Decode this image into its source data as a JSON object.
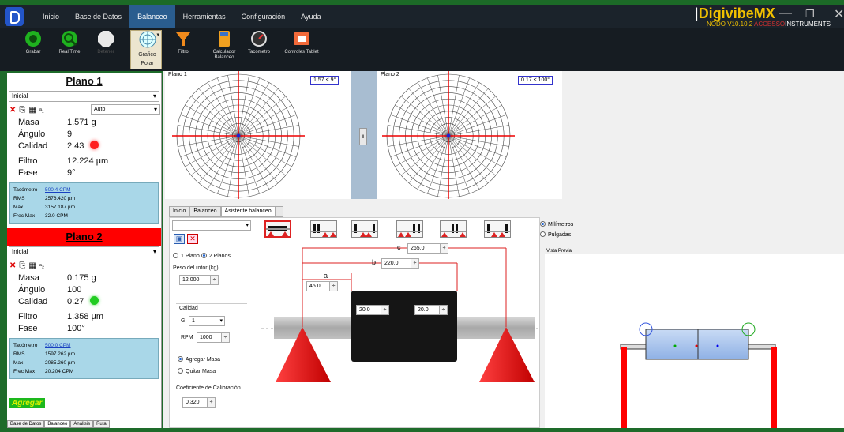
{
  "titlebar": {
    "menu": [
      "Inicio",
      "Base de Datos",
      "Balanceo",
      "Herramientas",
      "Configuración",
      "Ayuda"
    ],
    "active_menu": "Balanceo",
    "brand": "DigivibeMX",
    "brand_version": "NODO V10.10.2",
    "brand_sub_acc": "ACCESSO",
    "brand_sub_ins": "INSTRUMENTS"
  },
  "ribbon": {
    "buttons": [
      {
        "label": "Grabar",
        "icon": "record-icon"
      },
      {
        "label": "Real Time",
        "icon": "realtime-icon"
      },
      {
        "label": "Detener",
        "icon": "stop-icon"
      },
      {
        "label": "Grafico Polar",
        "icon": "polar-chart-icon"
      },
      {
        "label": "Filtro",
        "icon": "filter-icon"
      },
      {
        "label": "Calculador Balanceo",
        "icon": "calculator-icon"
      },
      {
        "label": "Tacómetro",
        "icon": "tachometer-icon"
      },
      {
        "label": "Controles Tablet",
        "icon": "tablet-icon"
      }
    ]
  },
  "plano1": {
    "title": "Plano 1",
    "combo": "Inicial",
    "mode": "Auto",
    "masa_label": "Masa",
    "masa": "1.571 g",
    "angulo_label": "Ángulo",
    "angulo": "9",
    "calidad_label": "Calidad",
    "calidad": "2.43",
    "calidad_color": "#ff2020",
    "filtro_label": "Filtro",
    "filtro": "12.224 µm",
    "fase_label": "Fase",
    "fase": "9°",
    "info": [
      {
        "k": "Tacómetro",
        "v": "500.4 CPM"
      },
      {
        "k": "RMS",
        "v": "2576.420 µm"
      },
      {
        "k": "Max",
        "v": "3157.187 µm"
      },
      {
        "k": "Frec Max",
        "v": "32.0 CPM"
      }
    ]
  },
  "plano2": {
    "title": "Plano 2",
    "combo": "Inicial",
    "masa_label": "Masa",
    "masa": "0.175 g",
    "angulo_label": "Ángulo",
    "angulo": "100",
    "calidad_label": "Calidad",
    "calidad": "0.27",
    "calidad_color": "#22cc22",
    "filtro_label": "Filtro",
    "filtro": "1.358 µm",
    "fase_label": "Fase",
    "fase": "100°",
    "info": [
      {
        "k": "Tacómetro",
        "v": "500.0 CPM"
      },
      {
        "k": "RMS",
        "v": "1597.262 µm"
      },
      {
        "k": "Max",
        "v": "2085.260 µm"
      },
      {
        "k": "Frec Max",
        "v": "20.204 CPM"
      }
    ]
  },
  "agregar": "Agregar",
  "bottom_tabs": [
    "Base de Datos",
    "Balanceo",
    "Análisis",
    "Ruta"
  ],
  "polar": {
    "plano1_label": "Plano 1",
    "plano1_value": "1.57 < 9°",
    "plano2_label": "Plano 2",
    "plano2_value": "0.17 < 100°"
  },
  "tabs": [
    "Inicio",
    "Balanceo",
    "Asistente balanceo"
  ],
  "active_tab": "Asistente balanceo",
  "wizard": {
    "planos_1": "1 Plano",
    "planos_2": "2 Planos",
    "peso_label": "Peso del rotor (kg)",
    "peso": "12.000",
    "calidad_label": "Calidad",
    "g_label": "G",
    "g_value": "1",
    "rpm_label": "RPM",
    "rpm": "1000",
    "agregar_masa": "Agregar Masa",
    "quitar_masa": "Quitar Masa",
    "coef_label": "Coeficiente de Calibración",
    "coef": "0.320",
    "c_label": "c",
    "c_value": "265.0",
    "b_label": "b",
    "b_value": "220.0",
    "a_label": "a",
    "a_value": "45.0",
    "d1": "20.0",
    "d2": "20.0",
    "units_mm": "Milímetros",
    "units_in": "Pulgadas",
    "vista": "Vista Previa"
  }
}
